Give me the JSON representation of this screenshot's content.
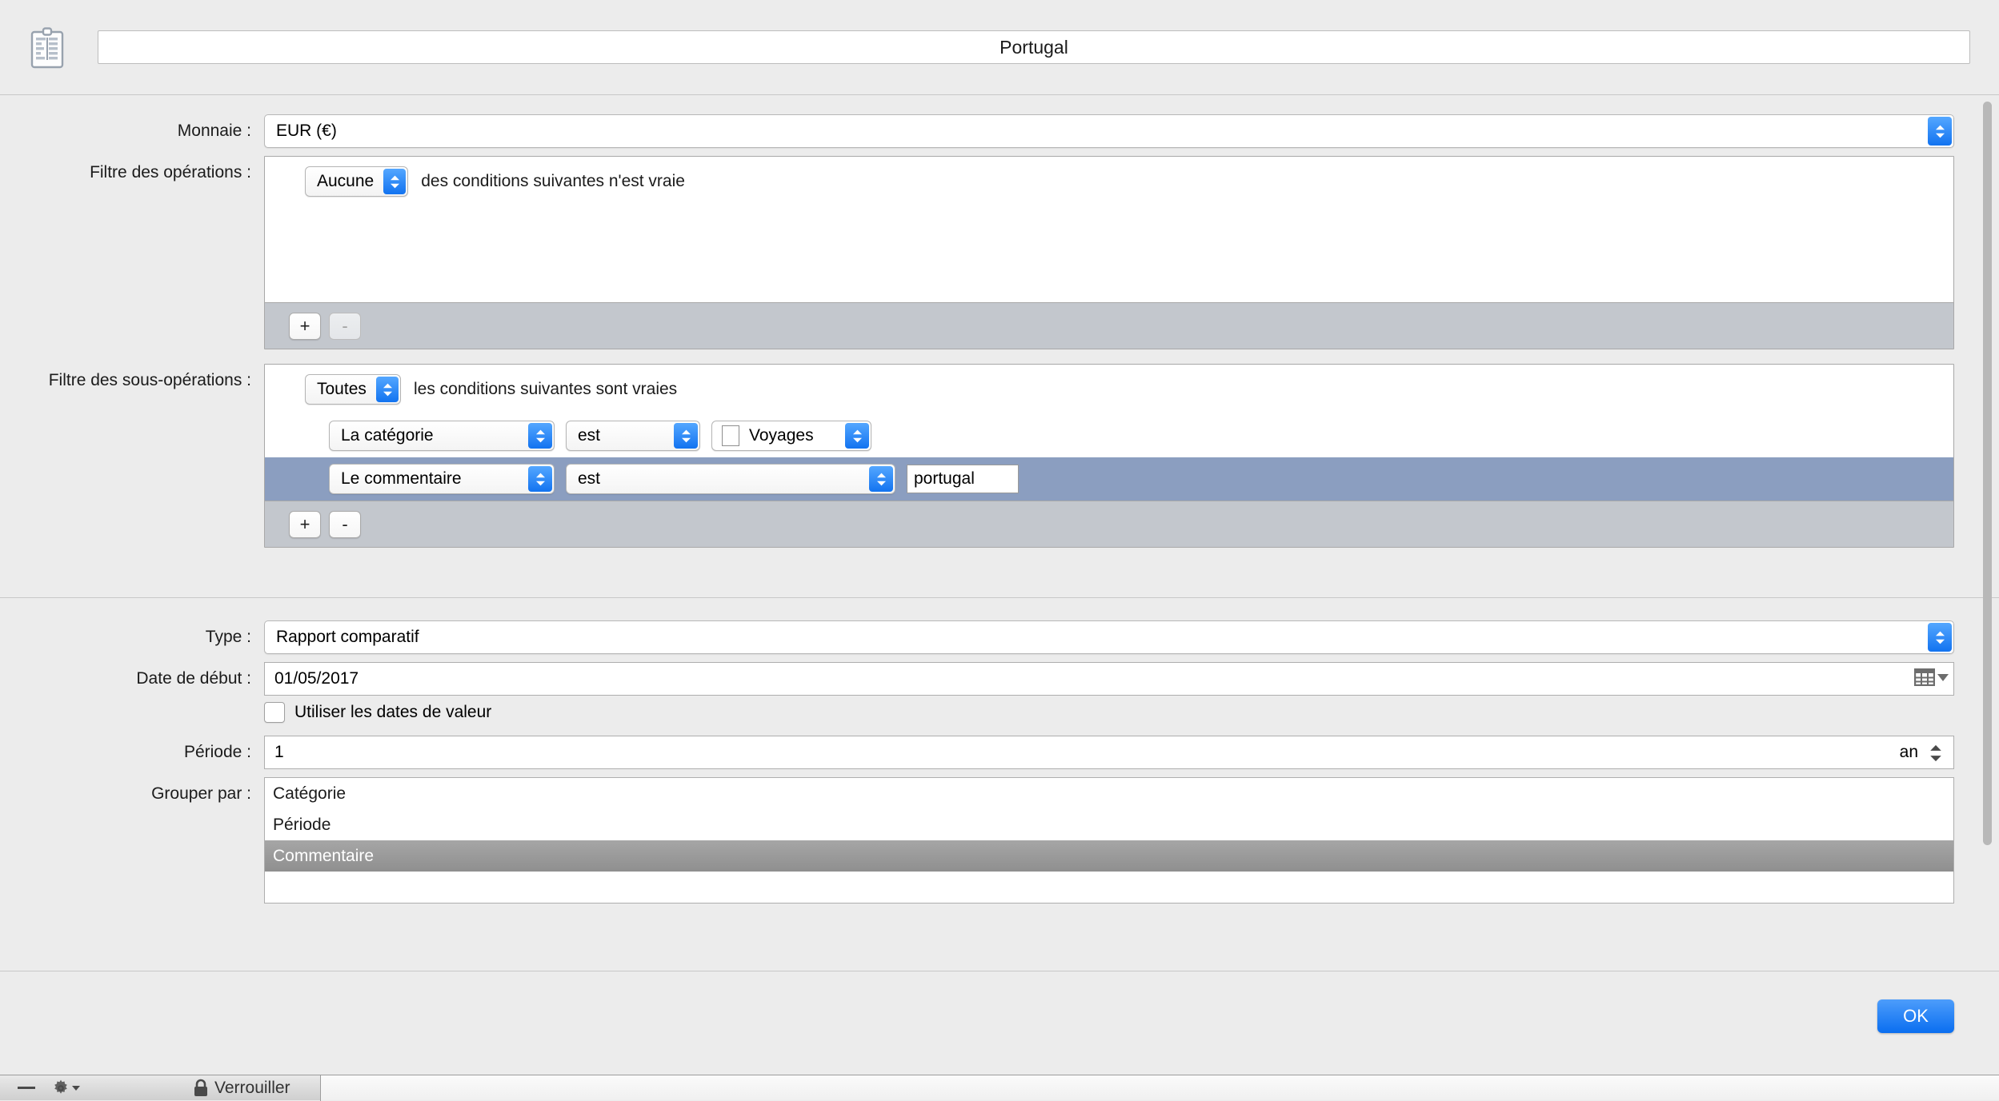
{
  "window": {
    "icon": "report-clipboard-icon",
    "title_value": "Portugal"
  },
  "form": {
    "currency": {
      "label": "Monnaie :",
      "value": "EUR (€)"
    },
    "operations_filter": {
      "label": "Filtre des opérations :",
      "match_mode": "Aucune",
      "match_text": "des conditions suivantes n'est vraie",
      "add_label": "+",
      "remove_label": "-",
      "conditions": []
    },
    "suboperations_filter": {
      "label": "Filtre des sous-opérations :",
      "match_mode": "Toutes",
      "match_text": "les conditions suivantes sont vraies",
      "add_label": "+",
      "remove_label": "-",
      "conditions": [
        {
          "field": "La catégorie",
          "operator": "est",
          "value": "Voyages"
        },
        {
          "field": "Le commentaire",
          "operator": "est",
          "value": "portugal"
        }
      ]
    },
    "type": {
      "label": "Type :",
      "value": "Rapport comparatif"
    },
    "start_date": {
      "label": "Date de début :",
      "value": "01/05/2017"
    },
    "use_value_dates": {
      "label": "Utiliser les dates de valeur",
      "checked": false
    },
    "period": {
      "label": "Période :",
      "value": "1",
      "unit": "an"
    },
    "group_by": {
      "label": "Grouper par :",
      "items": [
        {
          "label": "Catégorie",
          "selected": false
        },
        {
          "label": "Période",
          "selected": false
        },
        {
          "label": "Commentaire",
          "selected": true
        }
      ]
    }
  },
  "footer": {
    "ok_label": "OK"
  },
  "statusbar": {
    "lock_label": "Verrouiller"
  },
  "colors": {
    "accent_blue": "#1273f0",
    "selected_row": "#8b9ec0",
    "list_selection": "#9a9a9a",
    "window_bg": "#ececec"
  }
}
